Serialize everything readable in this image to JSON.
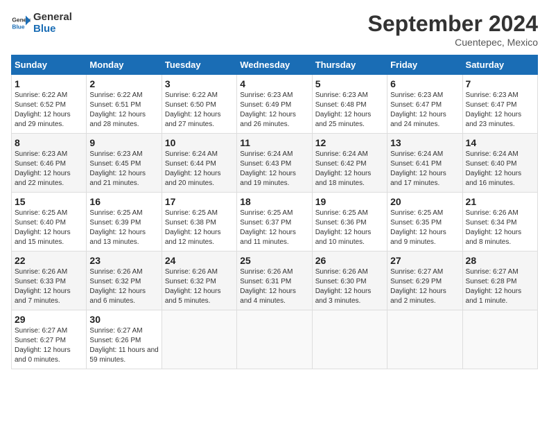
{
  "header": {
    "logo_line1": "General",
    "logo_line2": "Blue",
    "month_title": "September 2024",
    "location": "Cuentepec, Mexico"
  },
  "days_of_week": [
    "Sunday",
    "Monday",
    "Tuesday",
    "Wednesday",
    "Thursday",
    "Friday",
    "Saturday"
  ],
  "weeks": [
    [
      {
        "day": "1",
        "sunrise": "6:22 AM",
        "sunset": "6:52 PM",
        "daylight": "12 hours and 29 minutes."
      },
      {
        "day": "2",
        "sunrise": "6:22 AM",
        "sunset": "6:51 PM",
        "daylight": "12 hours and 28 minutes."
      },
      {
        "day": "3",
        "sunrise": "6:22 AM",
        "sunset": "6:50 PM",
        "daylight": "12 hours and 27 minutes."
      },
      {
        "day": "4",
        "sunrise": "6:23 AM",
        "sunset": "6:49 PM",
        "daylight": "12 hours and 26 minutes."
      },
      {
        "day": "5",
        "sunrise": "6:23 AM",
        "sunset": "6:48 PM",
        "daylight": "12 hours and 25 minutes."
      },
      {
        "day": "6",
        "sunrise": "6:23 AM",
        "sunset": "6:47 PM",
        "daylight": "12 hours and 24 minutes."
      },
      {
        "day": "7",
        "sunrise": "6:23 AM",
        "sunset": "6:47 PM",
        "daylight": "12 hours and 23 minutes."
      }
    ],
    [
      {
        "day": "8",
        "sunrise": "6:23 AM",
        "sunset": "6:46 PM",
        "daylight": "12 hours and 22 minutes."
      },
      {
        "day": "9",
        "sunrise": "6:23 AM",
        "sunset": "6:45 PM",
        "daylight": "12 hours and 21 minutes."
      },
      {
        "day": "10",
        "sunrise": "6:24 AM",
        "sunset": "6:44 PM",
        "daylight": "12 hours and 20 minutes."
      },
      {
        "day": "11",
        "sunrise": "6:24 AM",
        "sunset": "6:43 PM",
        "daylight": "12 hours and 19 minutes."
      },
      {
        "day": "12",
        "sunrise": "6:24 AM",
        "sunset": "6:42 PM",
        "daylight": "12 hours and 18 minutes."
      },
      {
        "day": "13",
        "sunrise": "6:24 AM",
        "sunset": "6:41 PM",
        "daylight": "12 hours and 17 minutes."
      },
      {
        "day": "14",
        "sunrise": "6:24 AM",
        "sunset": "6:40 PM",
        "daylight": "12 hours and 16 minutes."
      }
    ],
    [
      {
        "day": "15",
        "sunrise": "6:25 AM",
        "sunset": "6:40 PM",
        "daylight": "12 hours and 15 minutes."
      },
      {
        "day": "16",
        "sunrise": "6:25 AM",
        "sunset": "6:39 PM",
        "daylight": "12 hours and 13 minutes."
      },
      {
        "day": "17",
        "sunrise": "6:25 AM",
        "sunset": "6:38 PM",
        "daylight": "12 hours and 12 minutes."
      },
      {
        "day": "18",
        "sunrise": "6:25 AM",
        "sunset": "6:37 PM",
        "daylight": "12 hours and 11 minutes."
      },
      {
        "day": "19",
        "sunrise": "6:25 AM",
        "sunset": "6:36 PM",
        "daylight": "12 hours and 10 minutes."
      },
      {
        "day": "20",
        "sunrise": "6:25 AM",
        "sunset": "6:35 PM",
        "daylight": "12 hours and 9 minutes."
      },
      {
        "day": "21",
        "sunrise": "6:26 AM",
        "sunset": "6:34 PM",
        "daylight": "12 hours and 8 minutes."
      }
    ],
    [
      {
        "day": "22",
        "sunrise": "6:26 AM",
        "sunset": "6:33 PM",
        "daylight": "12 hours and 7 minutes."
      },
      {
        "day": "23",
        "sunrise": "6:26 AM",
        "sunset": "6:32 PM",
        "daylight": "12 hours and 6 minutes."
      },
      {
        "day": "24",
        "sunrise": "6:26 AM",
        "sunset": "6:32 PM",
        "daylight": "12 hours and 5 minutes."
      },
      {
        "day": "25",
        "sunrise": "6:26 AM",
        "sunset": "6:31 PM",
        "daylight": "12 hours and 4 minutes."
      },
      {
        "day": "26",
        "sunrise": "6:26 AM",
        "sunset": "6:30 PM",
        "daylight": "12 hours and 3 minutes."
      },
      {
        "day": "27",
        "sunrise": "6:27 AM",
        "sunset": "6:29 PM",
        "daylight": "12 hours and 2 minutes."
      },
      {
        "day": "28",
        "sunrise": "6:27 AM",
        "sunset": "6:28 PM",
        "daylight": "12 hours and 1 minute."
      }
    ],
    [
      {
        "day": "29",
        "sunrise": "6:27 AM",
        "sunset": "6:27 PM",
        "daylight": "12 hours and 0 minutes."
      },
      {
        "day": "30",
        "sunrise": "6:27 AM",
        "sunset": "6:26 PM",
        "daylight": "11 hours and 59 minutes."
      },
      null,
      null,
      null,
      null,
      null
    ]
  ],
  "labels": {
    "sunrise": "Sunrise: ",
    "sunset": "Sunset: ",
    "daylight": "Daylight: "
  }
}
